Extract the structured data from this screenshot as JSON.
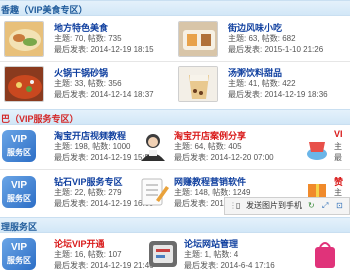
{
  "sections": {
    "food": {
      "title": "香趣（VIP美食专区）"
    },
    "vip": {
      "title": "巴（VIP服务专区）"
    },
    "service": {
      "title": "理服务区"
    }
  },
  "forums": {
    "local_food": {
      "name": "地方特色美食",
      "stats": "主题: 70, 帖数: 735",
      "last": "最后发表: 2014-12-19 18:15"
    },
    "street_snack": {
      "name": "街边风味小吃",
      "stats": "主题: 63, 帖数: 682",
      "last": "最后发表: 2015-1-10 21:26"
    },
    "hotpot": {
      "name": "火锅干锅砂锅",
      "stats": "主题: 33, 帖数: 356",
      "last": "最后发表: 2014-12-14 18:37"
    },
    "soup": {
      "name": "汤粥饮料甜品",
      "stats": "主题: 41, 帖数: 422",
      "last": "最后发表: 2014-12-19 18:36"
    },
    "taobao_video": {
      "name": "淘宝开店视频教程",
      "stats": "主题: 198, 帖数: 1000",
      "last": "最后发表: 2014-12-19 15:52"
    },
    "taobao_share": {
      "name": "淘宝开店案例分享",
      "stats": "主题: 64, 帖数: 405",
      "last": "最后发表: 2014-12-20 07:00"
    },
    "diamond_vip": {
      "name": "钻石VIP服务专区",
      "stats": "主题: 22, 帖数: 279",
      "last": "最后发表: 2014-12-19 16:09"
    },
    "web_marketing": {
      "name": "网赚教程营销软件",
      "stats": "主题: 148, 帖数: 1249",
      "last": "最后发表: 2014-12-19 15:52"
    },
    "forum_vip": {
      "name": "论坛VIP开通",
      "stats": "主题: 16, 帖数: 107",
      "last": "最后发表: 2014-12-19 21:46"
    },
    "site_admin": {
      "name": "论坛网站管理",
      "stats": "主题: 1, 帖数: 4",
      "last": "最后发表: 2014-6-4 17:16"
    }
  },
  "partial": {
    "vip_right": "VI",
    "vip_right2": "主",
    "vip_right3": "最",
    "zuan_right": "赞",
    "zuan_right2": "主",
    "badge_vip": "VIP",
    "badge_service": "服务区"
  },
  "toolbar": {
    "send_label": "发送图片到手机"
  },
  "colors": {
    "header_bg": "#d2e7f7",
    "title_blue": "#1e5a9a",
    "title_red": "#d42727",
    "link_blue": "#0f3f9f",
    "link_red": "#d91a1a"
  }
}
